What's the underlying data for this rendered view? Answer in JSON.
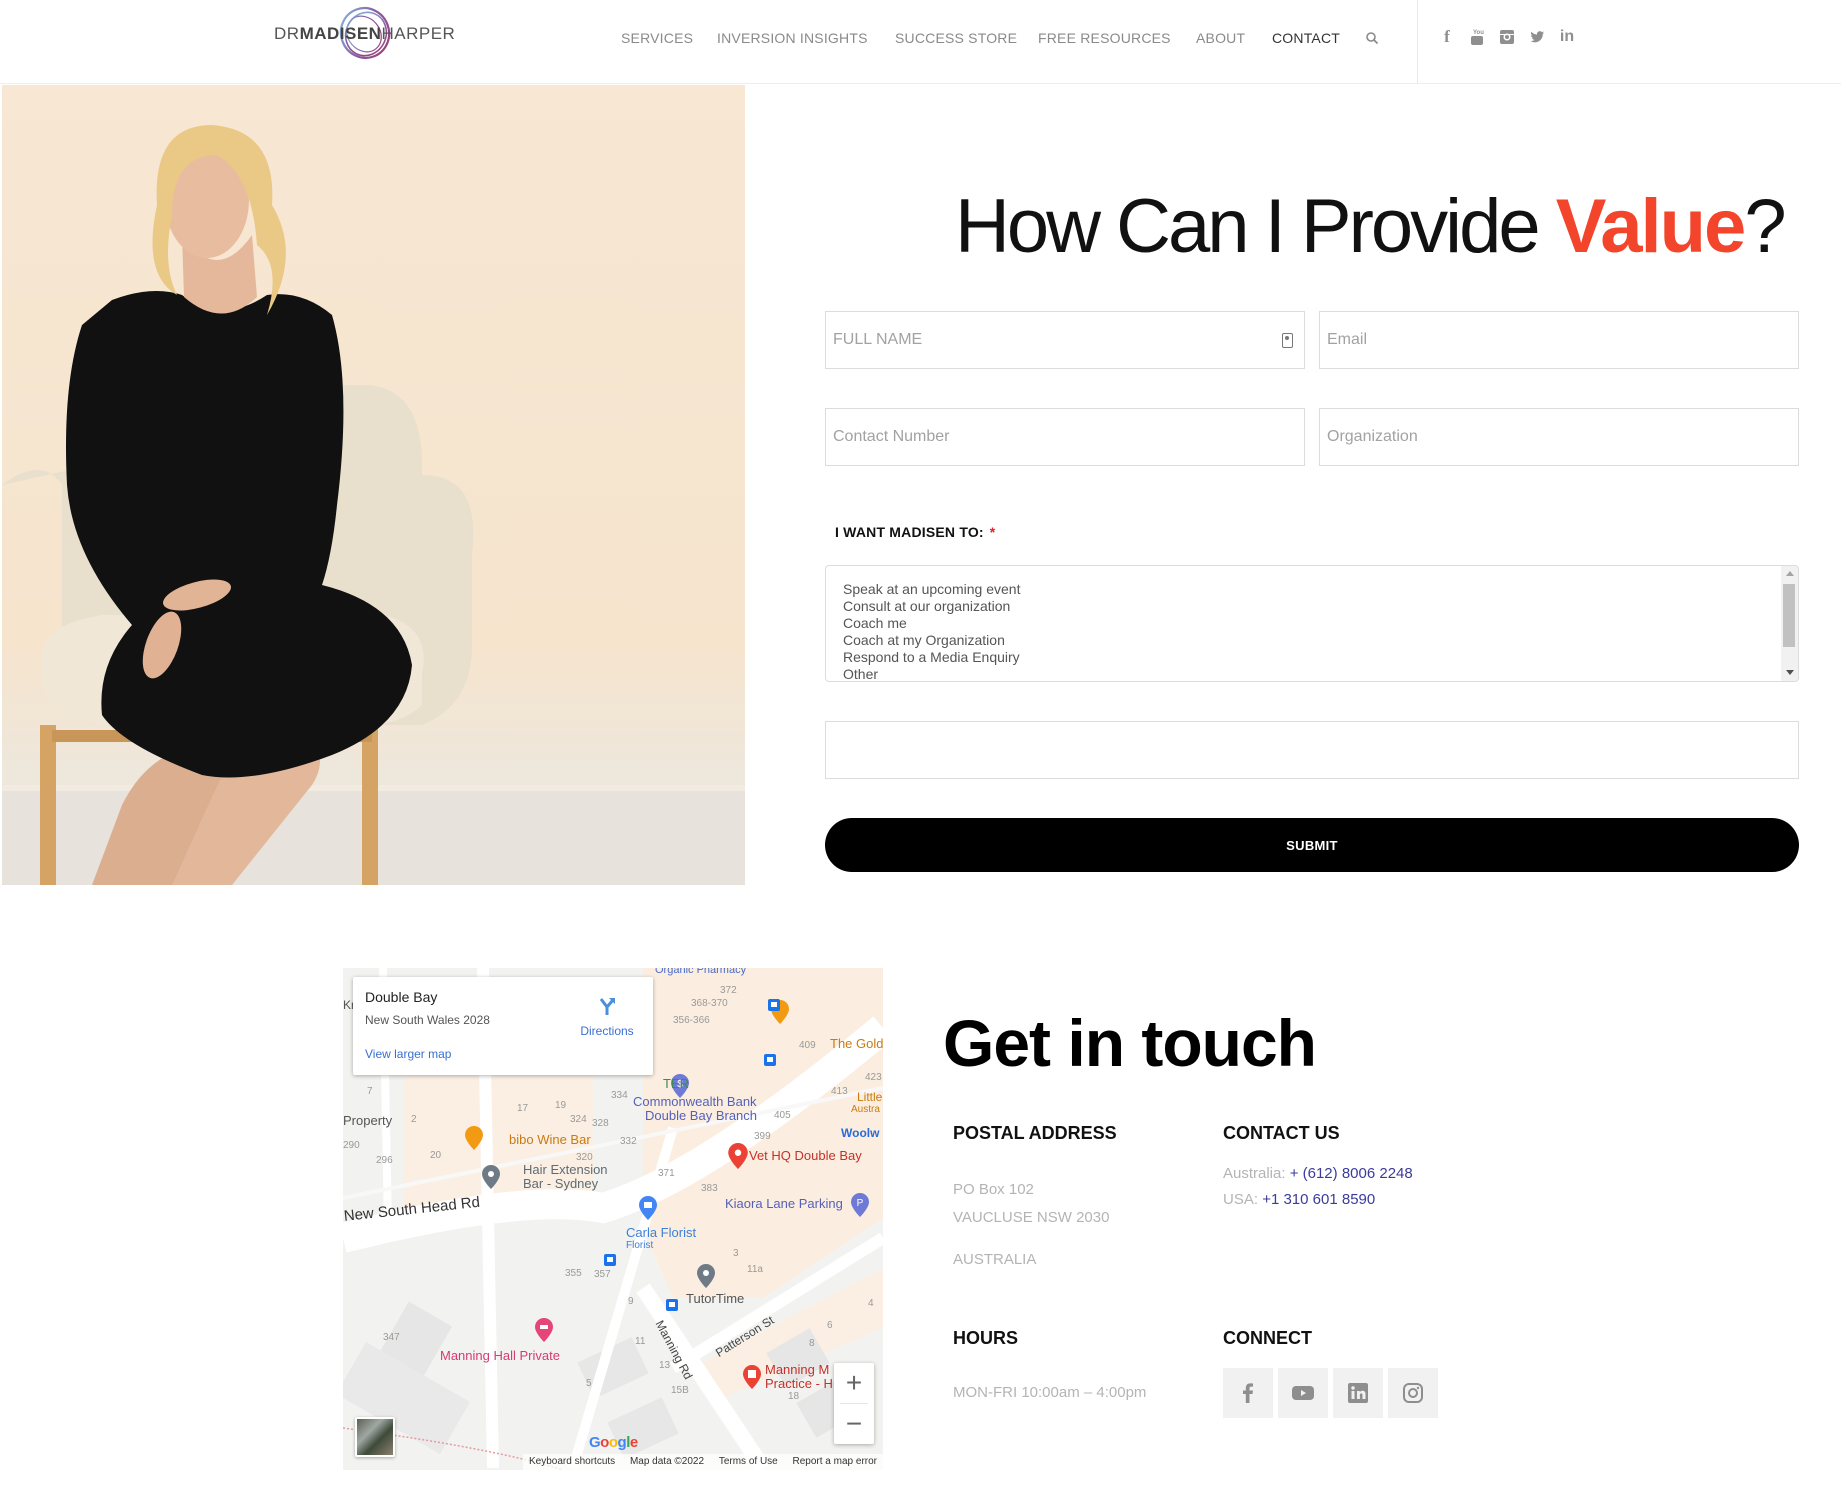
{
  "header": {
    "logo": {
      "prefix": "DR",
      "middle": "MADISEN",
      "suffix": "HARPER"
    },
    "nav": [
      {
        "label": "SERVICES",
        "active": false
      },
      {
        "label": "INVERSION INSIGHTS",
        "active": false
      },
      {
        "label": "SUCCESS STORE",
        "active": false
      },
      {
        "label": "FREE RESOURCES",
        "active": false
      },
      {
        "label": "ABOUT",
        "active": false
      },
      {
        "label": "CONTACT",
        "active": true
      }
    ],
    "search_icon": "search-icon",
    "social": [
      "facebook-icon",
      "youtube-icon",
      "instagram-icon",
      "twitter-icon",
      "linkedin-icon"
    ],
    "social_glyphs": {
      "facebook": "f",
      "linkedin": "in"
    }
  },
  "form": {
    "title_main": "How Can I Provide ",
    "title_accent": "Value",
    "title_end": "?",
    "accent_color": "#f2452b",
    "fields": {
      "full_name": {
        "placeholder": "FULL NAME",
        "value": ""
      },
      "email": {
        "placeholder": "Email",
        "value": ""
      },
      "contact_number": {
        "placeholder": "Contact Number",
        "value": ""
      },
      "organization": {
        "placeholder": "Organization",
        "value": ""
      },
      "message": {
        "placeholder": "",
        "value": ""
      }
    },
    "want_label": "I WANT MADISEN TO:",
    "required_marker": "*",
    "options": [
      "Speak at an upcoming event",
      "Consult at our organization",
      "Coach me",
      "Coach at my Organization",
      "Respond to a Media Enquiry",
      "Other"
    ],
    "submit_label": "SUBMIT"
  },
  "map": {
    "place_name": "Double Bay",
    "place_address": "New South Wales 2028",
    "directions_label": "Directions",
    "view_larger_label": "View larger map",
    "labels": {
      "organic_pharmacy": "Organic Pharmacy",
      "commonwealth_1": "Commonwealth Bank",
      "commonwealth_2": "Double Bay Branch",
      "bibo": "bibo Wine Bar",
      "hair_1": "Hair Extension",
      "hair_2": "Bar - Sydney",
      "vet": "Vet HQ Double Bay",
      "kiaora": "Kiaora Lane Parking",
      "carla": "Carla Florist",
      "carla_sub": "Florist",
      "tutortime": "TutorTime",
      "manning_hall": "Manning Hall Private",
      "manning_med_1": "Manning M",
      "manning_med_2": "Practice - H",
      "the_gold": "The Gold",
      "little": "Little",
      "austra": "Austra",
      "woolw": "Woolw",
      "ter": "TER",
      "property": "Property",
      "kr": "Kr",
      "nsh_rd": "New South Head Rd",
      "manning_rd": "Manning Rd",
      "patterson_st": "Patterson St"
    },
    "numbers": [
      "372",
      "368-370",
      "356-366",
      "409",
      "423",
      "413",
      "405",
      "399",
      "334",
      "332",
      "328",
      "324",
      "320",
      "371",
      "383",
      "355",
      "357",
      "347",
      "11a",
      "9",
      "11",
      "13",
      "15B",
      "5",
      "8",
      "6",
      "4",
      "18",
      "3",
      "2",
      "290",
      "296",
      "20",
      "17",
      "19",
      "7",
      "11",
      "15"
    ],
    "zoom_in": "+",
    "zoom_out": "−",
    "google": "Google",
    "footer": [
      "Keyboard shortcuts",
      "Map data ©2022",
      "Terms of Use",
      "Report a map error"
    ]
  },
  "contact": {
    "title": "Get in touch",
    "postal": {
      "heading": "POSTAL ADDRESS",
      "line1": "PO Box 102",
      "line2": "VAUCLUSE  NSW  2030",
      "line3": "AUSTRALIA"
    },
    "contact_us": {
      "heading": "CONTACT US",
      "au_label": "Australia: ",
      "au_phone": "+ (612) 8006 2248",
      "us_label": "USA: ",
      "us_phone": "+1 310 601 8590"
    },
    "hours": {
      "heading": "HOURS",
      "text": "MON-FRI 10:00am – 4:00pm"
    },
    "connect": {
      "heading": "CONNECT",
      "icons": [
        "facebook-icon",
        "youtube-icon",
        "linkedin-icon",
        "instagram-icon"
      ]
    }
  }
}
